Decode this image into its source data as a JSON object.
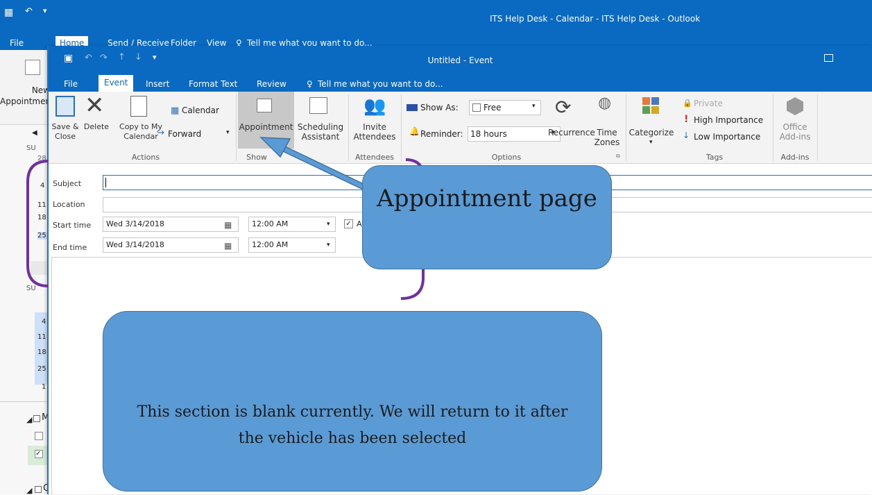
{
  "outer": {
    "title": "ITS Help Desk - Calendar - ITS Help Desk - Outlook",
    "tabs": [
      "File",
      "Home",
      "Send / Receive",
      "Folder",
      "View"
    ],
    "tell_me": "Tell me what you want to do...",
    "new_appointment": "New Appointment",
    "weekday_header": "SU",
    "dates_top": [
      "28",
      "4",
      "11",
      "18",
      "25"
    ],
    "dates_bottom": [
      "4",
      "11",
      "18",
      "25",
      "1"
    ],
    "folder_group": "M",
    "other_group": "O"
  },
  "event": {
    "title": "Untitled - Event",
    "tabs": [
      "File",
      "Event",
      "Insert",
      "Format Text",
      "Review"
    ],
    "tell_me": "Tell me what you want to do...",
    "ribbon": {
      "save_close": "Save & Close",
      "delete": "Delete",
      "copy_to_calendar": "Copy to My Calendar",
      "calendar": "Calendar",
      "forward": "Forward",
      "appointment": "Appointment",
      "scheduling_assistant": "Scheduling Assistant",
      "invite_attendees": "Invite Attendees",
      "show_as_label": "Show As:",
      "show_as_value": "Free",
      "reminder_label": "Reminder:",
      "reminder_value": "18 hours",
      "recurrence": "Recurrence",
      "time_zones": "Time Zones",
      "categorize": "Categorize",
      "private": "Private",
      "high_importance": "High Importance",
      "low_importance": "Low Importance",
      "office_addins": "Office Add-ins",
      "groups": [
        "Actions",
        "Show",
        "Attendees",
        "Options",
        "Tags",
        "Add-ins"
      ]
    },
    "form": {
      "subject_label": "Subject",
      "location_label": "Location",
      "start_label": "Start time",
      "end_label": "End time",
      "start_date": "Wed 3/14/2018",
      "start_time": "12:00 AM",
      "end_date": "Wed 3/14/2018",
      "end_time": "12:00 AM",
      "all_day_label": "A"
    }
  },
  "callouts": {
    "appointment": "Appointment page",
    "blank": "This section is blank currently. We will return to it after the vehicle has been selected"
  },
  "colors": {
    "brand": "#0a6ac2",
    "callout_fill": "#5b9bd5",
    "bracket": "#7030a0"
  }
}
